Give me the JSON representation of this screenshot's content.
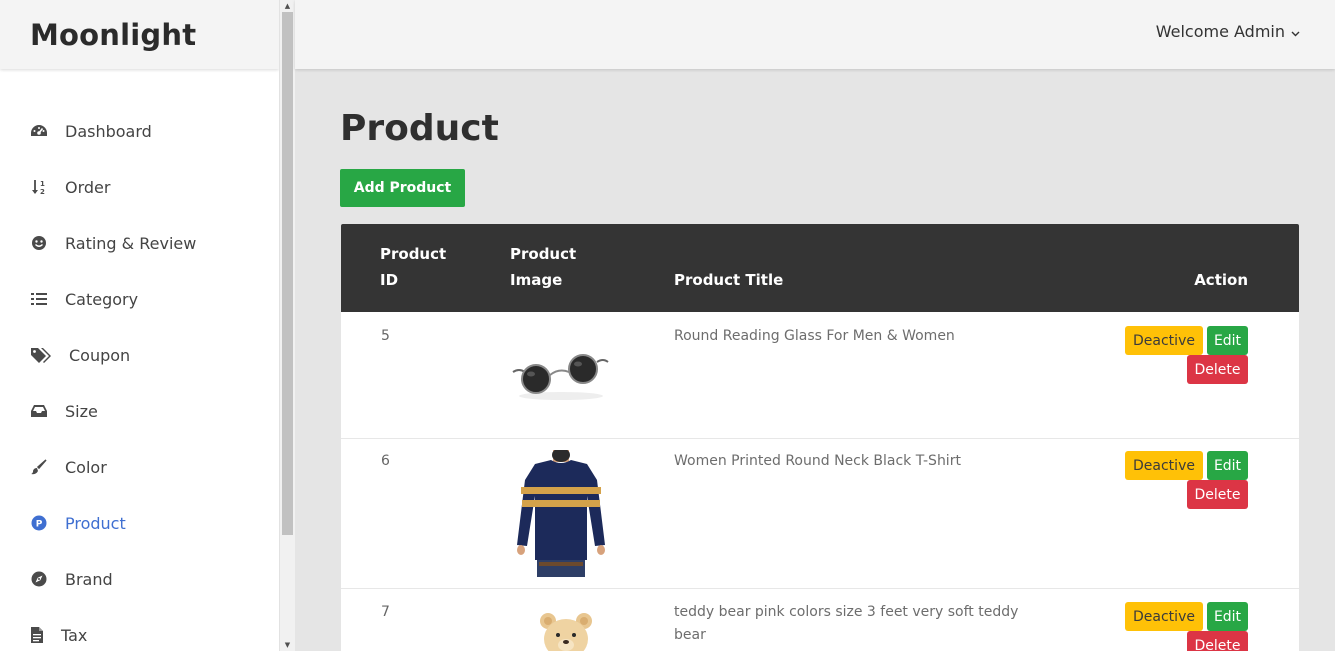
{
  "brand": "Moonlight",
  "header": {
    "welcome": "Welcome Admin"
  },
  "sidebar": {
    "items": [
      {
        "label": "Dashboard",
        "icon": "dashboard-icon"
      },
      {
        "label": "Order",
        "icon": "sort-icon"
      },
      {
        "label": "Rating & Review",
        "icon": "smile-icon"
      },
      {
        "label": "Category",
        "icon": "list-icon"
      },
      {
        "label": "Coupon",
        "icon": "tags-icon"
      },
      {
        "label": "Size",
        "icon": "inbox-icon"
      },
      {
        "label": "Color",
        "icon": "brush-icon"
      },
      {
        "label": "Product",
        "icon": "product-icon",
        "active": true
      },
      {
        "label": "Brand",
        "icon": "compass-icon"
      },
      {
        "label": "Tax",
        "icon": "file-icon"
      }
    ]
  },
  "page": {
    "title": "Product",
    "add_button": "Add Product"
  },
  "table": {
    "columns": {
      "id_line1": "Product",
      "id_line2": "ID",
      "image_line1": "Product",
      "image_line2": "Image",
      "title": "Product Title",
      "action": "Action"
    },
    "rows": [
      {
        "id": "5",
        "title": "Round Reading Glass For Men & Women",
        "image": "sunglasses"
      },
      {
        "id": "6",
        "title": "Women Printed Round Neck Black T-Shirt",
        "image": "tshirt"
      },
      {
        "id": "7",
        "title": "teddy bear pink colors size 3 feet very soft teddy bear",
        "image": "teddy-bear"
      }
    ],
    "actions": {
      "deactivate": "Deactive",
      "edit": "Edit",
      "delete": "Delete"
    }
  },
  "colors": {
    "accent": "#3f6fd1",
    "success": "#28a745",
    "warning": "#ffc107",
    "danger": "#dc3545",
    "table_header": "#343434"
  }
}
